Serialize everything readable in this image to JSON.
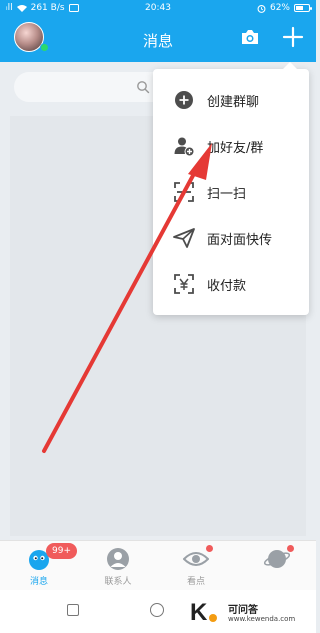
{
  "status_bar": {
    "signal": "ᵢll",
    "network_speed": "261 B/s",
    "time": "20:43",
    "battery_percent": "62%",
    "battery_level": 0.62
  },
  "header": {
    "title": "消息"
  },
  "menu": {
    "items": [
      {
        "label": "创建群聊",
        "icon": "add-circle-icon"
      },
      {
        "label": "加好友/群",
        "icon": "add-friend-icon"
      },
      {
        "label": "扫一扫",
        "icon": "scan-icon"
      },
      {
        "label": "面对面快传",
        "icon": "paper-plane-icon"
      },
      {
        "label": "收付款",
        "icon": "payment-icon"
      }
    ]
  },
  "bottom_nav": {
    "tabs": [
      {
        "label": "消息",
        "icon": "qq-penguin-icon",
        "active": true
      },
      {
        "label": "联系人",
        "icon": "contacts-icon"
      },
      {
        "label": "看点",
        "icon": "eye-icon"
      },
      {
        "label": "",
        "icon": "planet-icon"
      }
    ],
    "badge": "99+"
  },
  "watermark": {
    "logo": "K",
    "title": "可问答",
    "url": "www.kewenda.com"
  },
  "colors": {
    "accent": "#1aa6ee",
    "annotation": "#e53935",
    "badge": "#f05b5b"
  }
}
